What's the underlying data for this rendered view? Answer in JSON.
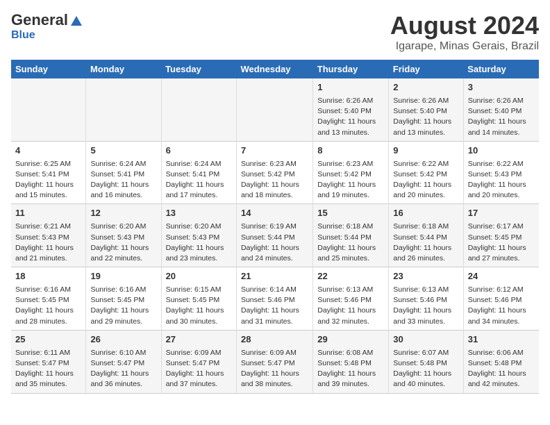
{
  "logo": {
    "general": "General",
    "blue": "Blue"
  },
  "title": "August 2024",
  "subtitle": "Igarape, Minas Gerais, Brazil",
  "days_of_week": [
    "Sunday",
    "Monday",
    "Tuesday",
    "Wednesday",
    "Thursday",
    "Friday",
    "Saturday"
  ],
  "weeks": [
    [
      {
        "day": "",
        "info": ""
      },
      {
        "day": "",
        "info": ""
      },
      {
        "day": "",
        "info": ""
      },
      {
        "day": "",
        "info": ""
      },
      {
        "day": "1",
        "info": "Sunrise: 6:26 AM\nSunset: 5:40 PM\nDaylight: 11 hours and 13 minutes."
      },
      {
        "day": "2",
        "info": "Sunrise: 6:26 AM\nSunset: 5:40 PM\nDaylight: 11 hours and 13 minutes."
      },
      {
        "day": "3",
        "info": "Sunrise: 6:26 AM\nSunset: 5:40 PM\nDaylight: 11 hours and 14 minutes."
      }
    ],
    [
      {
        "day": "4",
        "info": "Sunrise: 6:25 AM\nSunset: 5:41 PM\nDaylight: 11 hours and 15 minutes."
      },
      {
        "day": "5",
        "info": "Sunrise: 6:24 AM\nSunset: 5:41 PM\nDaylight: 11 hours and 16 minutes."
      },
      {
        "day": "6",
        "info": "Sunrise: 6:24 AM\nSunset: 5:41 PM\nDaylight: 11 hours and 17 minutes."
      },
      {
        "day": "7",
        "info": "Sunrise: 6:23 AM\nSunset: 5:42 PM\nDaylight: 11 hours and 18 minutes."
      },
      {
        "day": "8",
        "info": "Sunrise: 6:23 AM\nSunset: 5:42 PM\nDaylight: 11 hours and 19 minutes."
      },
      {
        "day": "9",
        "info": "Sunrise: 6:22 AM\nSunset: 5:42 PM\nDaylight: 11 hours and 20 minutes."
      },
      {
        "day": "10",
        "info": "Sunrise: 6:22 AM\nSunset: 5:43 PM\nDaylight: 11 hours and 20 minutes."
      }
    ],
    [
      {
        "day": "11",
        "info": "Sunrise: 6:21 AM\nSunset: 5:43 PM\nDaylight: 11 hours and 21 minutes."
      },
      {
        "day": "12",
        "info": "Sunrise: 6:20 AM\nSunset: 5:43 PM\nDaylight: 11 hours and 22 minutes."
      },
      {
        "day": "13",
        "info": "Sunrise: 6:20 AM\nSunset: 5:43 PM\nDaylight: 11 hours and 23 minutes."
      },
      {
        "day": "14",
        "info": "Sunrise: 6:19 AM\nSunset: 5:44 PM\nDaylight: 11 hours and 24 minutes."
      },
      {
        "day": "15",
        "info": "Sunrise: 6:18 AM\nSunset: 5:44 PM\nDaylight: 11 hours and 25 minutes."
      },
      {
        "day": "16",
        "info": "Sunrise: 6:18 AM\nSunset: 5:44 PM\nDaylight: 11 hours and 26 minutes."
      },
      {
        "day": "17",
        "info": "Sunrise: 6:17 AM\nSunset: 5:45 PM\nDaylight: 11 hours and 27 minutes."
      }
    ],
    [
      {
        "day": "18",
        "info": "Sunrise: 6:16 AM\nSunset: 5:45 PM\nDaylight: 11 hours and 28 minutes."
      },
      {
        "day": "19",
        "info": "Sunrise: 6:16 AM\nSunset: 5:45 PM\nDaylight: 11 hours and 29 minutes."
      },
      {
        "day": "20",
        "info": "Sunrise: 6:15 AM\nSunset: 5:45 PM\nDaylight: 11 hours and 30 minutes."
      },
      {
        "day": "21",
        "info": "Sunrise: 6:14 AM\nSunset: 5:46 PM\nDaylight: 11 hours and 31 minutes."
      },
      {
        "day": "22",
        "info": "Sunrise: 6:13 AM\nSunset: 5:46 PM\nDaylight: 11 hours and 32 minutes."
      },
      {
        "day": "23",
        "info": "Sunrise: 6:13 AM\nSunset: 5:46 PM\nDaylight: 11 hours and 33 minutes."
      },
      {
        "day": "24",
        "info": "Sunrise: 6:12 AM\nSunset: 5:46 PM\nDaylight: 11 hours and 34 minutes."
      }
    ],
    [
      {
        "day": "25",
        "info": "Sunrise: 6:11 AM\nSunset: 5:47 PM\nDaylight: 11 hours and 35 minutes."
      },
      {
        "day": "26",
        "info": "Sunrise: 6:10 AM\nSunset: 5:47 PM\nDaylight: 11 hours and 36 minutes."
      },
      {
        "day": "27",
        "info": "Sunrise: 6:09 AM\nSunset: 5:47 PM\nDaylight: 11 hours and 37 minutes."
      },
      {
        "day": "28",
        "info": "Sunrise: 6:09 AM\nSunset: 5:47 PM\nDaylight: 11 hours and 38 minutes."
      },
      {
        "day": "29",
        "info": "Sunrise: 6:08 AM\nSunset: 5:48 PM\nDaylight: 11 hours and 39 minutes."
      },
      {
        "day": "30",
        "info": "Sunrise: 6:07 AM\nSunset: 5:48 PM\nDaylight: 11 hours and 40 minutes."
      },
      {
        "day": "31",
        "info": "Sunrise: 6:06 AM\nSunset: 5:48 PM\nDaylight: 11 hours and 42 minutes."
      }
    ]
  ]
}
